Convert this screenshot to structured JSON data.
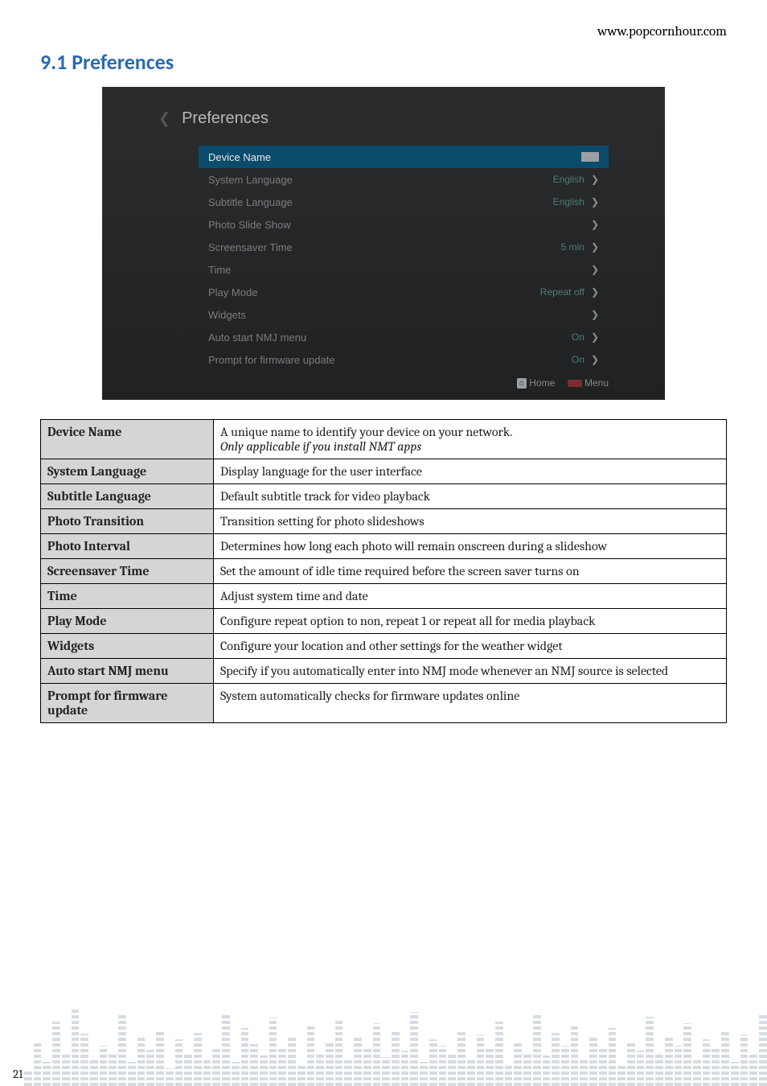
{
  "header": {
    "url": "www.popcornhour.com"
  },
  "section": {
    "number": "9.1",
    "title": "Preferences"
  },
  "screenshot": {
    "title": "Preferences",
    "items": [
      {
        "label": "Device Name",
        "value": "",
        "selected": true,
        "input": true
      },
      {
        "label": "System Language",
        "value": "English"
      },
      {
        "label": "Subtitle Language",
        "value": "English"
      },
      {
        "label": "Photo Slide Show",
        "value": ""
      },
      {
        "label": "Screensaver Time",
        "value": "5 min"
      },
      {
        "label": "Time",
        "value": ""
      },
      {
        "label": "Play Mode",
        "value": "Repeat off"
      },
      {
        "label": "Widgets",
        "value": ""
      },
      {
        "label": "Auto start NMJ menu",
        "value": "On"
      },
      {
        "label": "Prompt for firmware update",
        "value": "On"
      }
    ],
    "footer": {
      "home": "Home",
      "menu": "Menu"
    }
  },
  "table": {
    "rows": [
      {
        "term": "Device Name",
        "desc1": "A unique name to identify your device on your network.",
        "desc2_em": "Only applicable if you install NMT apps"
      },
      {
        "term": "System Language",
        "desc1": "Display language for the user interface"
      },
      {
        "term": "Subtitle Language",
        "desc1": "Default subtitle track for video playback"
      },
      {
        "term": "Photo Transition",
        "desc1": "Transition setting for photo slideshows"
      },
      {
        "term": "Photo Interval",
        "desc1": "Determines how long each photo will remain onscreen during a slideshow"
      },
      {
        "term": "Screensaver Time",
        "desc1": "Set the amount of idle time required before the screen saver turns on"
      },
      {
        "term": "Time",
        "desc1": "Adjust system time and date"
      },
      {
        "term": "Play Mode",
        "desc1": "Configure repeat option to non, repeat 1 or repeat all for media playback"
      },
      {
        "term": "Widgets",
        "desc1": "Configure your location and other settings for the weather widget"
      },
      {
        "term": "Auto start NMJ menu",
        "desc1": "Specify if you automatically enter into NMJ mode whenever an NMJ source is selected"
      },
      {
        "term": "Prompt for firmware update",
        "desc1": "System automatically checks for firmware updates online"
      }
    ]
  },
  "page_number": "21"
}
